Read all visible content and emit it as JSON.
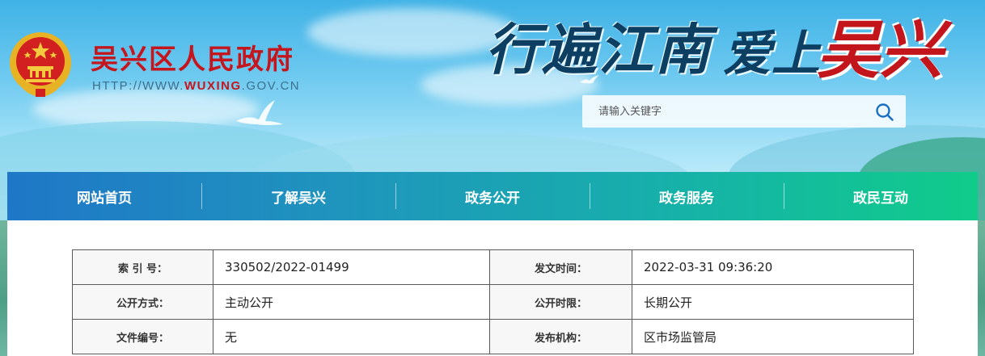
{
  "header": {
    "site_name": "吴兴区人民政府",
    "url_prefix": "HTTP://WWW.",
    "url_domain": "WUXING",
    "url_suffix": ".GOV.CN",
    "slogan_part1": "行遍江南",
    "slogan_part2": "爱上",
    "slogan_part3": "吴兴",
    "search_placeholder": "请输入关键字",
    "emblem_icon": "national-emblem-icon",
    "search_icon": "search-icon"
  },
  "nav": {
    "items": [
      "网站首页",
      "了解吴兴",
      "政务公开",
      "政务服务",
      "政民互动"
    ]
  },
  "meta_table": {
    "rows": [
      {
        "label1": "索 引 号：",
        "value1": "330502/2022-01499",
        "label2": "发文时间：",
        "value2": "2022-03-31 09:36:20"
      },
      {
        "label1": "公开方式：",
        "value1": "主动公开",
        "label2": "公开时限：",
        "value2": "长期公开"
      },
      {
        "label1": "文件编号：",
        "value1": "无",
        "label2": "发布机构：",
        "value2": "区市场监管局"
      }
    ]
  },
  "colors": {
    "brand_red": "#c6161d",
    "nav_start": "#1f77c7",
    "nav_end": "#10cc8a"
  }
}
